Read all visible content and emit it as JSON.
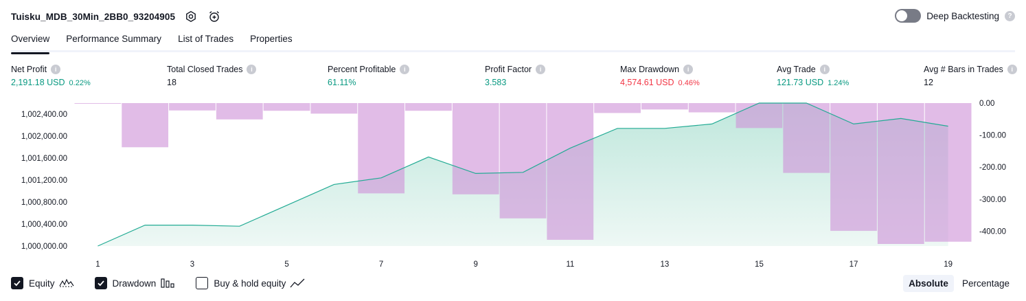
{
  "header": {
    "strategy_name": "Tuisku_MDB_30Min_2BB0_93204905",
    "settings_icon": "settings-gear-icon",
    "add_alert_icon": "alarm-clock-plus-icon",
    "deep_backtesting_label": "Deep Backtesting",
    "deep_backtesting_enabled": false
  },
  "tabs": [
    {
      "label": "Overview",
      "active": true
    },
    {
      "label": "Performance Summary",
      "active": false
    },
    {
      "label": "List of Trades",
      "active": false
    },
    {
      "label": "Properties",
      "active": false
    }
  ],
  "metrics": [
    {
      "label": "Net Profit",
      "value": "2,191.18 USD",
      "pct": "0.22%",
      "color": "green"
    },
    {
      "label": "Total Closed Trades",
      "value": "18",
      "pct": "",
      "color": "dark"
    },
    {
      "label": "Percent Profitable",
      "value": "61.11%",
      "pct": "",
      "color": "green"
    },
    {
      "label": "Profit Factor",
      "value": "3.583",
      "pct": "",
      "color": "green"
    },
    {
      "label": "Max Drawdown",
      "value": "4,574.61 USD",
      "pct": "0.46%",
      "color": "red"
    },
    {
      "label": "Avg Trade",
      "value": "121.73 USD",
      "pct": "1.24%",
      "color": "green"
    },
    {
      "label": "Avg # Bars in Trades",
      "value": "12",
      "pct": "",
      "color": "dark"
    }
  ],
  "chart_data": {
    "type": "line",
    "x": [
      1,
      2,
      3,
      4,
      5,
      6,
      7,
      8,
      9,
      10,
      11,
      12,
      13,
      14,
      15,
      16,
      17,
      18,
      19
    ],
    "x_tick_labels": [
      "1",
      "3",
      "5",
      "7",
      "9",
      "11",
      "13",
      "15",
      "17",
      "19"
    ],
    "left_axis": {
      "ticks": [
        "1,000,000.00",
        "1,000,400.00",
        "1,000,800.00",
        "1,001,200.00",
        "1,001,600.00",
        "1,002,000.00",
        "1,002,400.00"
      ],
      "ylim": [
        1000000,
        1002600
      ]
    },
    "right_axis": {
      "ticks": [
        "0.00",
        "-100.00",
        "-200.00",
        "-300.00",
        "-400.00"
      ],
      "ylim": [
        -440,
        0
      ]
    },
    "series": [
      {
        "name": "Equity",
        "kind": "area",
        "axis": "left",
        "color": "#22ab94",
        "values": [
          1000000,
          1000380,
          1000380,
          1000360,
          1000740,
          1001120,
          1001240,
          1001620,
          1001320,
          1001340,
          1001780,
          1002140,
          1002140,
          1002220,
          1002600,
          1002600,
          1002220,
          1002320,
          1002180
        ]
      },
      {
        "name": "Drawdown",
        "kind": "bar",
        "axis": "right",
        "color": "#ce93d8",
        "values": [
          -2,
          -138,
          -23,
          -51,
          -24,
          -33,
          -282,
          -24,
          -285,
          -360,
          -427,
          -31,
          -20,
          -29,
          -78,
          -218,
          -399,
          -440,
          -433
        ]
      }
    ],
    "grid": false,
    "legend_position": "bottom-left"
  },
  "legend": [
    {
      "label": "Equity",
      "checked": true,
      "icon": "equity-wave-icon"
    },
    {
      "label": "Drawdown",
      "checked": true,
      "icon": "drawdown-bars-icon"
    },
    {
      "label": "Buy & hold equity",
      "checked": false,
      "icon": "buy-hold-line-icon"
    }
  ],
  "mode": {
    "absolute_label": "Absolute",
    "percentage_label": "Percentage",
    "active": "Absolute"
  }
}
